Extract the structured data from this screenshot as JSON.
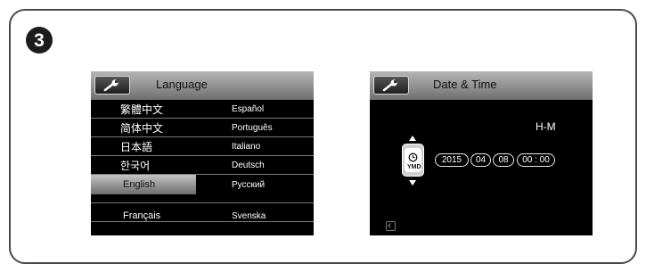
{
  "step": {
    "number": "3"
  },
  "language_screen": {
    "title": "Language",
    "icon": "wrench-icon",
    "rows": [
      {
        "left": "繁體中文",
        "right": "Español"
      },
      {
        "left": "简体中文",
        "right": "Português"
      },
      {
        "left": "日本語",
        "right": "Italiano"
      },
      {
        "left": "한국어",
        "right": "Deutsch"
      },
      {
        "left": "English",
        "right": "Русский"
      },
      {
        "left": "Français",
        "right": "Svenska"
      }
    ],
    "selected": "English"
  },
  "datetime_screen": {
    "title": "Date & Time",
    "icon": "wrench-icon",
    "format_label": "H-M",
    "date_format_icon_text": "YMD",
    "year": "2015",
    "month": "04",
    "day": "08",
    "time": "00 : 00"
  }
}
